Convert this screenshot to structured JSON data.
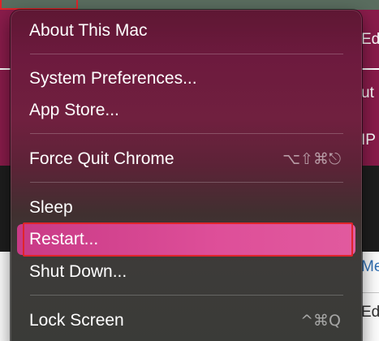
{
  "menu": {
    "items": [
      {
        "label": "About This Mac",
        "shortcut": ""
      },
      {
        "label": "System Preferences...",
        "shortcut": ""
      },
      {
        "label": "App Store...",
        "shortcut": ""
      },
      {
        "label": "Force Quit Chrome",
        "shortcut": "⌥⇧⌘⎋"
      },
      {
        "label": "Sleep",
        "shortcut": ""
      },
      {
        "label": "Restart...",
        "shortcut": ""
      },
      {
        "label": "Shut Down...",
        "shortcut": ""
      },
      {
        "label": "Lock Screen",
        "shortcut": "^⌘Q"
      }
    ],
    "highlighted_item": "Restart..."
  },
  "background_window": {
    "peek_texts": [
      "Ed",
      "ut",
      "IP",
      "Me",
      "Ed"
    ]
  },
  "colors": {
    "menu_top": "#6d1a3e",
    "highlight": "#de4f99",
    "annotation_outline": "#e0242b"
  }
}
